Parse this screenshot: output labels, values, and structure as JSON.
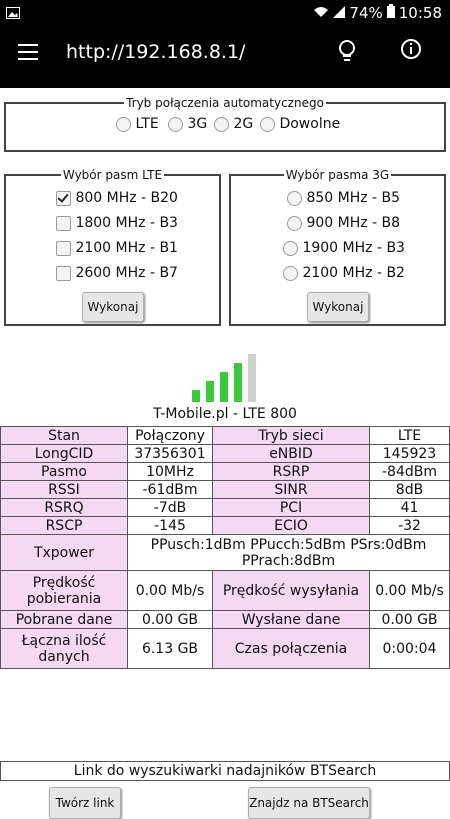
{
  "status": {
    "battery": "74%",
    "time": "10:58"
  },
  "appbar": {
    "url": "http://192.168.8.1/"
  },
  "mode": {
    "legend": "Tryb połączenia automatycznego",
    "options": [
      "LTE",
      "3G",
      "2G",
      "Dowolne"
    ]
  },
  "lte": {
    "legend": "Wybór pasm LTE",
    "bands": [
      "800 MHz - B20",
      "1800 MHz - B3",
      "2100 MHz - B1",
      "2600 MHz - B7"
    ],
    "checked": [
      true,
      false,
      false,
      false
    ],
    "button": "Wykonaj"
  },
  "g3": {
    "legend": "Wybór pasma 3G",
    "bands": [
      "850 MHz - B5",
      "900 MHz - B8",
      "1900 MHz - B3",
      "2100 MHz - B2"
    ],
    "button": "Wykonaj"
  },
  "signal": {
    "bars_active": 4,
    "bars_total": 5,
    "active_color": "#3cc83c",
    "inactive_color": "#cfcfcf"
  },
  "operator": "T-Mobile.pl - LTE 800",
  "table": {
    "stan": "Stan",
    "stan_v": "Połączony",
    "tryb": "Tryb sieci",
    "tryb_v": "LTE",
    "longcid": "LongCID",
    "longcid_v": "37356301",
    "enbid": "eNBID",
    "enbid_v": "145923",
    "pasmo": "Pasmo",
    "pasmo_v": "10MHz",
    "rsrp": "RSRP",
    "rsrp_v": "-84dBm",
    "rssi": "RSSI",
    "rssi_v": "-61dBm",
    "sinr": "SINR",
    "sinr_v": "8dB",
    "rsrq": "RSRQ",
    "rsrq_v": "-7dB",
    "pci": "PCI",
    "pci_v": "41",
    "rscp": "RSCP",
    "rscp_v": "-145",
    "ecio": "ECIO",
    "ecio_v": "-32",
    "txpower": "Txpower",
    "txpower_v": "PPusch:1dBm PPucch:5dBm PSrs:0dBm PPrach:8dBm",
    "dl": "Prędkość pobierania",
    "dl_v": "0.00 Mb/s",
    "ul": "Prędkość wysyłania",
    "ul_v": "0.00 Mb/s",
    "pobrane": "Pobrane dane",
    "pobrane_v": "0.00 GB",
    "wyslane": "Wysłane dane",
    "wyslane_v": "0.00 GB",
    "laczna": "Łączna ilość danych",
    "laczna_v": "6.13 GB",
    "czas": "Czas połączenia",
    "czas_v": "0:00:04"
  },
  "btsearch": {
    "link": "Link do wyszukiwarki nadajników BTSearch",
    "create": "Twórz link",
    "find": "Znajdz na BTSearch"
  }
}
